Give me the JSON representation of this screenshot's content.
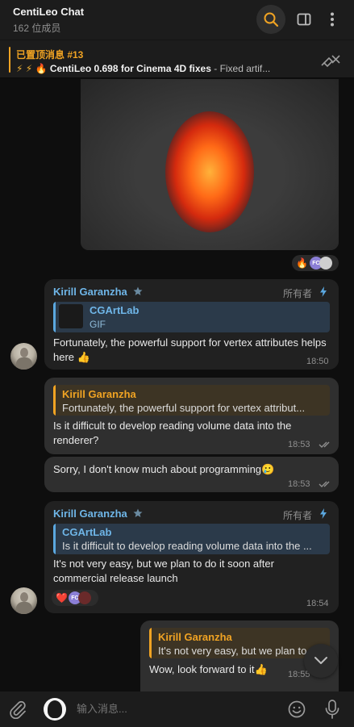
{
  "header": {
    "title": "CentiLeo Chat",
    "subtitle": "162 位成员"
  },
  "pinned": {
    "title": "已置顶消息 #13",
    "emojis": "⚡ ⚡ 🔥",
    "bold_text": "CentiLeo 0.698 for Cinema 4D fixes",
    "rest_text": "- Fixed artif..."
  },
  "reactions_top": {
    "emoji": "🔥",
    "badge": "FC"
  },
  "messages": [
    {
      "sender": "Kirill Garanzha",
      "role": "所有者",
      "quote_title": "CGArtLab",
      "quote_text": "GIF",
      "text": "Fortunately, the powerful support for vertex attributes helps here 👍",
      "time": "18:50"
    },
    {
      "quote_title": "Kirill Garanzha",
      "quote_text": "Fortunately, the powerful support for vertex attribut...",
      "text": "Is it difficult to develop reading volume data into the renderer?",
      "time": "18:53"
    },
    {
      "text": "Sorry, I don't know much about programming🥲",
      "time": "18:53"
    },
    {
      "sender": "Kirill Garanzha",
      "role": "所有者",
      "quote_title": "CGArtLab",
      "quote_text": "Is it difficult to develop reading volume data into the ...",
      "text": "It's not very easy, but we plan to do it soon after commercial release launch",
      "time": "18:54",
      "reaction_emoji": "❤️",
      "reaction_badge": "FC"
    },
    {
      "quote_title": "Kirill Garanzha",
      "quote_text": "It's not very easy, but we plan to do it soon after",
      "text": "Wow, look forward to it👍",
      "time": "18:55"
    }
  ],
  "composer": {
    "placeholder": "输入消息..."
  },
  "colors": {
    "accent_orange": "#f0a323",
    "accent_blue": "#6fb6e8",
    "background": "#0e0e0e",
    "bubble_in": "#212121",
    "bubble_out": "#2f2f2f"
  }
}
